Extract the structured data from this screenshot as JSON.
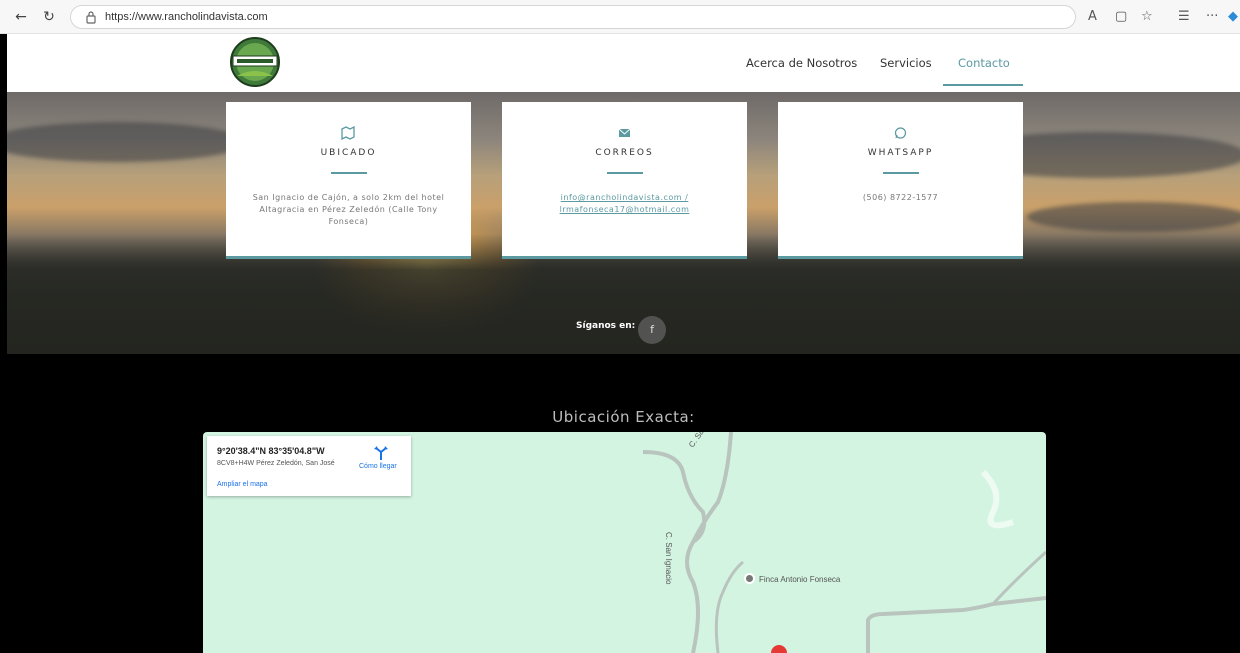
{
  "browser": {
    "url": "https://www.rancholindavista.com",
    "back_icon": "back-arrow-icon",
    "refresh_icon": "refresh-icon"
  },
  "header": {
    "logo_alt": "Lindavista logo",
    "nav": [
      {
        "label": "Acerca de Nosotros"
      },
      {
        "label": "Servicios"
      },
      {
        "label": "Contacto"
      }
    ]
  },
  "cards": [
    {
      "icon": "map-icon",
      "title": "UBICADO",
      "body": "San Ignacio de Cajón, a solo 2km del hotel Altagracia en Pérez Zeledón (Calle Tony Fonseca)"
    },
    {
      "icon": "envelope-icon",
      "title": "CORREOS",
      "body": "info@rancholindavista.com / lrmafonseca17@hotmail.com"
    },
    {
      "icon": "whatsapp-icon",
      "title": "WHATSAPP",
      "body": "(506) 8722-1577"
    }
  ],
  "social": {
    "follow_label": "Síganos en:",
    "facebook_glyph": "f"
  },
  "map_section": {
    "heading": "Ubicación Exacta:",
    "coords": "9°20'38.4\"N 83°35'04.8\"W",
    "pluscode": "8CV8+H4W Pérez Zeledón, San José",
    "directions_label": "Cómo llegar",
    "enlarge_label": "Ampliar el mapa",
    "road_label_1": "C. San Ignacio",
    "road_label_2": "C. San Ignacio",
    "poi_label": "Finca Antonio Fonseca"
  },
  "colors": {
    "accent": "#5b9aa0",
    "map_bg": "#d4f4e2"
  }
}
